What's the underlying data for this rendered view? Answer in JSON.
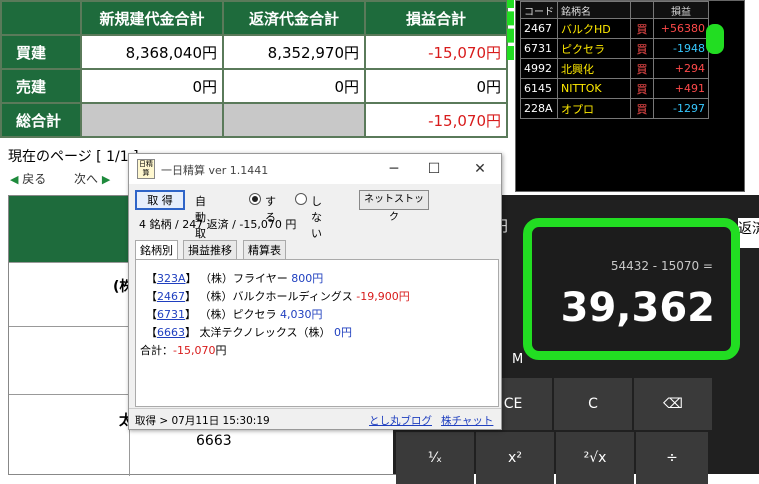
{
  "summary": {
    "headers": [
      "新規建代金合計",
      "返済代金合計",
      "損益合計"
    ],
    "rows": [
      {
        "label": "買建",
        "values": [
          "8,368,040円",
          "8,352,970円",
          "-15,070円"
        ]
      },
      {
        "label": "売建",
        "values": [
          "0円",
          "0円",
          "0円"
        ]
      },
      {
        "label": "総合計",
        "values": [
          "",
          "",
          "-15,070円"
        ]
      }
    ]
  },
  "nav": {
    "page": "現在のページ [ 1/1 ]",
    "prev": "戻る",
    "next": "次へ"
  },
  "background": {
    "left_text": "(株",
    "left_text2": "太",
    "code": "6663"
  },
  "stock_panel": {
    "headers": [
      "コード",
      "銘柄名",
      "",
      "損益"
    ],
    "rows": [
      {
        "code": "2467",
        "name": "バルクHD",
        "side": "買",
        "pl": "+56380",
        "sign": "pos"
      },
      {
        "code": "6731",
        "name": "ピクセラ",
        "side": "買",
        "pl": "-1948",
        "sign": "neg"
      },
      {
        "code": "4992",
        "name": "北興化",
        "side": "買",
        "pl": "+294",
        "sign": "pos"
      },
      {
        "code": "6145",
        "name": "NITTOK",
        "side": "買",
        "pl": "+491",
        "sign": "pos"
      },
      {
        "code": "228A",
        "name": "オプロ",
        "side": "買",
        "pl": "-1297",
        "sign": "neg"
      }
    ]
  },
  "calculator": {
    "expression": "54432 - 15070 =",
    "result": "39,362",
    "memory_label": "M",
    "behind_label": "円",
    "side_label": "返済",
    "keys": [
      "CE",
      "C",
      "⌫",
      "¹⁄ₓ",
      "x²",
      "²√x",
      "÷"
    ]
  },
  "popup": {
    "icon_text": "日精算",
    "title": "一日精算 ver 1.1441",
    "btn_get": "取 得",
    "auto_label": "自動取得",
    "radio_on": "する",
    "radio_off": "しない",
    "btn_netstock": "ネットストック",
    "summary": "4 銘柄 / 247 返済 / -15,070 円",
    "tabs": [
      "銘柄別",
      "損益推移",
      "精算表"
    ],
    "items": [
      {
        "code": "323A",
        "name": "（株）フライヤー",
        "pl": "800円",
        "sign": "pos"
      },
      {
        "code": "2467",
        "name": "（株）バルクホールディングス",
        "pl": "-19,900円",
        "sign": "neg"
      },
      {
        "code": "6731",
        "name": "（株）ピクセラ",
        "pl": "4,030円",
        "sign": "pos"
      },
      {
        "code": "6663",
        "name": "太洋テクノレックス（株）",
        "pl": "0円",
        "sign": "pos"
      }
    ],
    "total_label": "合計：",
    "total_value": "-15,070",
    "total_unit": "円",
    "status": "取得 > 07月11日 15:30:19",
    "link1": "とし丸ブログ",
    "link2": "株チャット"
  }
}
